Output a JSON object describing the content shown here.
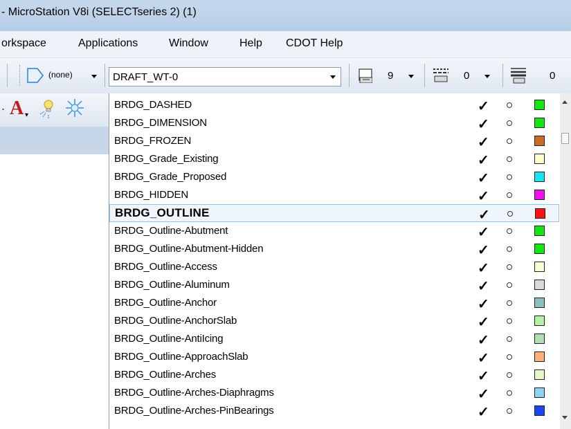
{
  "window": {
    "title": "- MicroStation V8i (SELECTseries 2) (1)"
  },
  "menu": {
    "items": [
      {
        "label": "orkspace"
      },
      {
        "label": "Applications"
      },
      {
        "label": "Window"
      },
      {
        "label": "Help"
      },
      {
        "label": "CDOT Help"
      }
    ]
  },
  "toolbar": {
    "none_label": "(none)",
    "level_combo_value": "DRAFT_WT-0",
    "color_value": "9",
    "style_value": "0",
    "weight_value": "0"
  },
  "colors": {
    "title_bar": "#c5d9ee",
    "menu_bar": "#eef3fa",
    "selection_border": "#93c4ea"
  },
  "level_list": {
    "rows": [
      {
        "name": "BRDG_DASHED",
        "swatch": "#13e613"
      },
      {
        "name": "BRDG_DIMENSION",
        "swatch": "#13e613"
      },
      {
        "name": "BRDG_FROZEN",
        "swatch": "#cc6a23"
      },
      {
        "name": "BRDG_Grade_Existing",
        "swatch": "#ffffcc"
      },
      {
        "name": "BRDG_Grade_Proposed",
        "swatch": "#16e6f0"
      },
      {
        "name": "BRDG_HIDDEN",
        "swatch": "#f010f0"
      },
      {
        "name": "BRDG_OUTLINE",
        "swatch": "#ff1010",
        "selected": true
      },
      {
        "name": "BRDG_Outline-Abutment",
        "swatch": "#13e613"
      },
      {
        "name": "BRDG_Outline-Abutment-Hidden",
        "swatch": "#13e613"
      },
      {
        "name": "BRDG_Outline-Access",
        "swatch": "#f4ffd6"
      },
      {
        "name": "BRDG_Outline-Aluminum",
        "swatch": "#d9d9d9"
      },
      {
        "name": "BRDG_Outline-Anchor",
        "swatch": "#8cbfbf"
      },
      {
        "name": "BRDG_Outline-AnchorSlab",
        "swatch": "#b6f0a8"
      },
      {
        "name": "BRDG_Outline-AntiIcing",
        "swatch": "#b4ddb4"
      },
      {
        "name": "BRDG_Outline-ApproachSlab",
        "swatch": "#ffb07a"
      },
      {
        "name": "BRDG_Outline-Arches",
        "swatch": "#e4f7c6"
      },
      {
        "name": "BRDG_Outline-Arches-Diaphragms",
        "swatch": "#8ed2f5"
      },
      {
        "name": "BRDG_Outline-Arches-PinBearings",
        "swatch": "#1e46f0"
      }
    ]
  }
}
